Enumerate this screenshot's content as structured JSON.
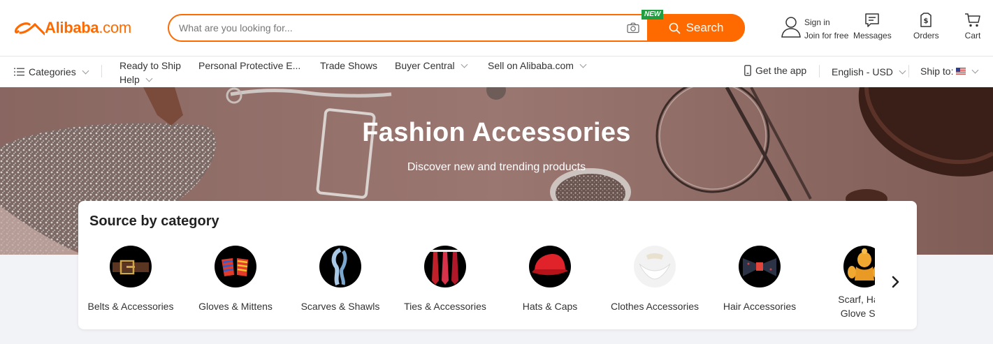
{
  "header": {
    "logo_brand": "Alibaba",
    "logo_domain": ".com",
    "search_placeholder": "What are you looking for...",
    "new_badge": "NEW",
    "search_button": "Search",
    "sign_in": "Sign in",
    "join_free": "Join for free",
    "messages": "Messages",
    "orders": "Orders",
    "cart": "Cart"
  },
  "nav": {
    "categories": "Categories",
    "ready_to_ship": "Ready to Ship",
    "ppe": "Personal Protective E...",
    "trade_shows": "Trade Shows",
    "buyer_central": "Buyer Central",
    "sell": "Sell on Alibaba.com",
    "help": "Help",
    "get_app": "Get the app",
    "language_currency": "English - USD",
    "ship_to": "Ship to:"
  },
  "banner": {
    "title": "Fashion Accessories",
    "subtitle": "Discover new and trending products"
  },
  "source_by_category": {
    "title": "Source by category",
    "items": [
      {
        "label": "Belts & Accessories",
        "icon": "belt-icon"
      },
      {
        "label": "Gloves & Mittens",
        "icon": "gloves-icon"
      },
      {
        "label": "Scarves & Shawls",
        "icon": "scarf-icon"
      },
      {
        "label": "Ties & Accessories",
        "icon": "ties-icon"
      },
      {
        "label": "Hats & Caps",
        "icon": "cap-icon"
      },
      {
        "label": "Clothes Accessories",
        "icon": "collar-icon"
      },
      {
        "label": "Hair Accessories",
        "icon": "bow-icon"
      },
      {
        "label": "Scarf, Hat & Glove Sets",
        "icon": "knit-set-icon"
      }
    ]
  },
  "colors": {
    "brand": "#ff6a00",
    "badge_green": "#1e9e3e"
  }
}
